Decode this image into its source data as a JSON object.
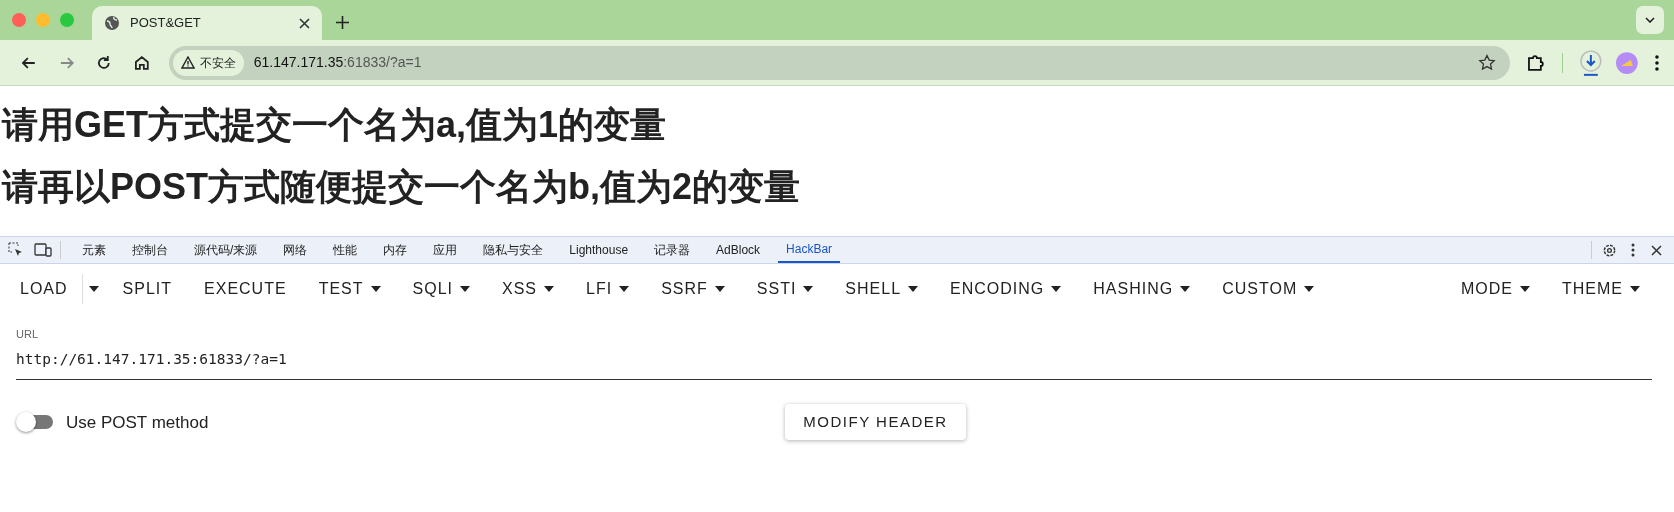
{
  "browser": {
    "tab": {
      "title": "POST&GET"
    },
    "address": {
      "security": "不安全",
      "host": "61.147.171.35",
      "path": ":61833/?a=1"
    }
  },
  "page": {
    "headings": [
      "请用GET方式提交一个名为a,值为1的变量",
      "请再以POST方式随便提交一个名为b,值为2的变量"
    ]
  },
  "devtools": {
    "tabs": [
      {
        "label": "元素",
        "selected": false
      },
      {
        "label": "控制台",
        "selected": false
      },
      {
        "label": "源代码/来源",
        "selected": false
      },
      {
        "label": "网络",
        "selected": false
      },
      {
        "label": "性能",
        "selected": false
      },
      {
        "label": "内存",
        "selected": false
      },
      {
        "label": "应用",
        "selected": false
      },
      {
        "label": "隐私与安全",
        "selected": false
      },
      {
        "label": "Lighthouse",
        "selected": false
      },
      {
        "label": "记录器",
        "selected": false
      },
      {
        "label": "AdBlock",
        "selected": false
      },
      {
        "label": "HackBar",
        "selected": true
      }
    ]
  },
  "hackbar": {
    "menu": [
      {
        "label": "LOAD",
        "kind": "split"
      },
      {
        "label": "SPLIT",
        "kind": "plain"
      },
      {
        "label": "EXECUTE",
        "kind": "plain"
      },
      {
        "label": "TEST",
        "kind": "dropdown"
      },
      {
        "label": "SQLI",
        "kind": "dropdown"
      },
      {
        "label": "XSS",
        "kind": "dropdown"
      },
      {
        "label": "LFI",
        "kind": "dropdown"
      },
      {
        "label": "SSRF",
        "kind": "dropdown"
      },
      {
        "label": "SSTI",
        "kind": "dropdown"
      },
      {
        "label": "SHELL",
        "kind": "dropdown"
      },
      {
        "label": "ENCODING",
        "kind": "dropdown"
      },
      {
        "label": "HASHING",
        "kind": "dropdown"
      },
      {
        "label": "CUSTOM",
        "kind": "dropdown"
      }
    ],
    "menu_right": [
      {
        "label": "MODE",
        "kind": "dropdown"
      },
      {
        "label": "THEME",
        "kind": "dropdown"
      }
    ],
    "url_field": {
      "label": "URL",
      "value": "http://61.147.171.35:61833/?a=1"
    },
    "post_toggle": {
      "label": "Use POST method",
      "on": false
    },
    "header_button": "MODIFY HEADER"
  }
}
